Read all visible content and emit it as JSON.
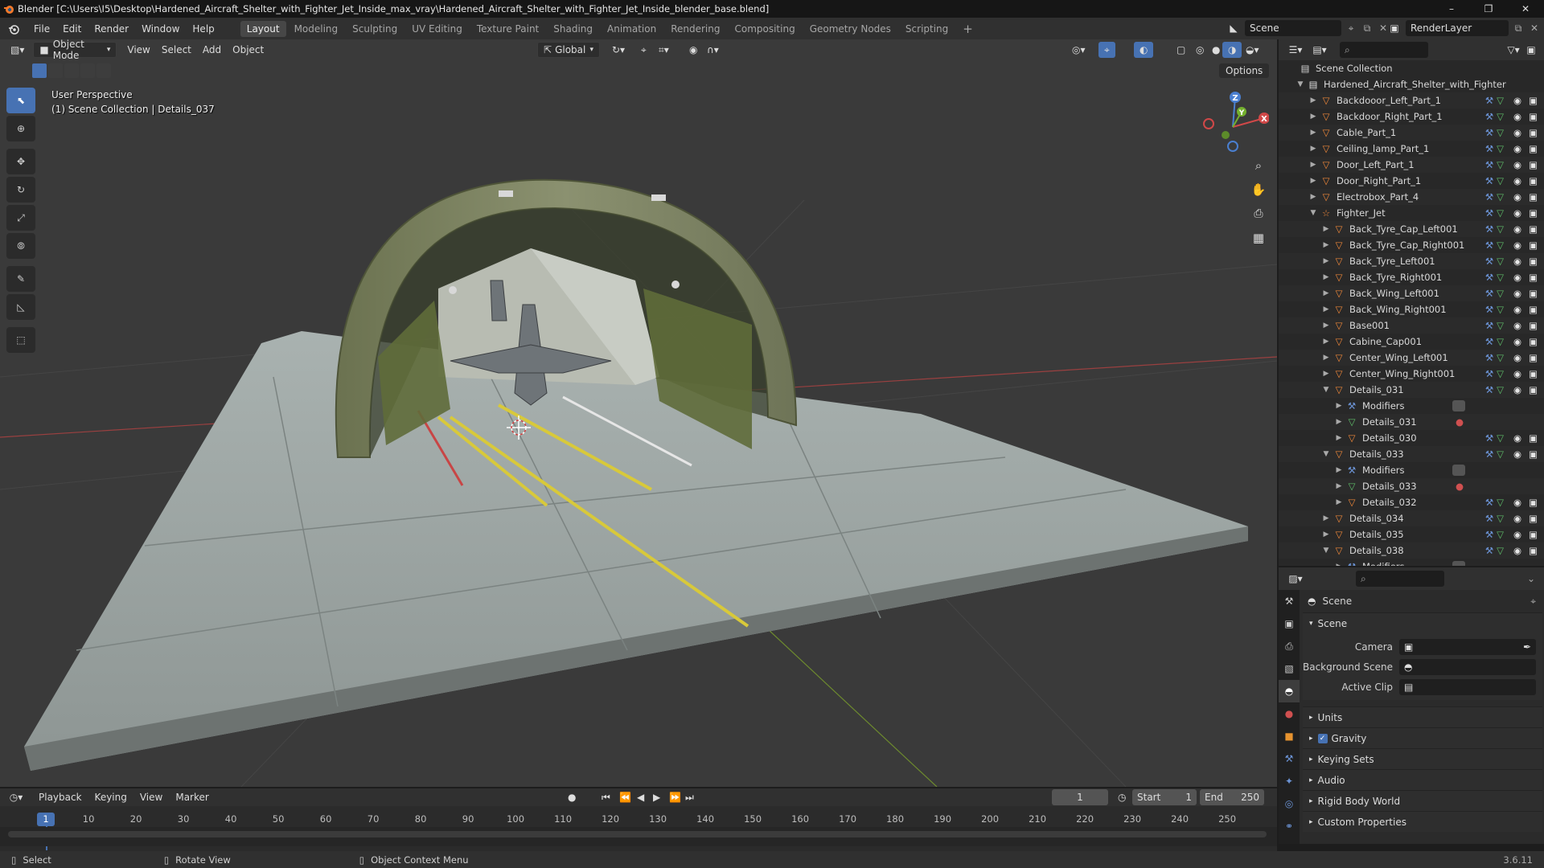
{
  "window": {
    "title": "Blender [C:\\Users\\I5\\Desktop\\Hardened_Aircraft_Shelter_with_Fighter_Jet_Inside_max_vray\\Hardened_Aircraft_Shelter_with_Fighter_Jet_Inside_blender_base.blend]"
  },
  "menu": [
    "File",
    "Edit",
    "Render",
    "Window",
    "Help"
  ],
  "workspaces": [
    "Layout",
    "Modeling",
    "Sculpting",
    "UV Editing",
    "Texture Paint",
    "Shading",
    "Animation",
    "Rendering",
    "Compositing",
    "Geometry Nodes",
    "Scripting"
  ],
  "active_workspace": "Layout",
  "add_workspace": "+",
  "scene_name": "Scene",
  "render_layer": "RenderLayer",
  "viewport": {
    "mode": "Object Mode",
    "menu": [
      "View",
      "Select",
      "Add",
      "Object"
    ],
    "orientation": "Global",
    "options": "Options",
    "perspective": "User Perspective",
    "collection_info": "(1) Scene Collection | Details_037",
    "gizmo_x": "X",
    "gizmo_y": "Y",
    "gizmo_z": "Z"
  },
  "outliner": {
    "root": "Scene Collection",
    "rows": [
      {
        "depth": 0,
        "label": "Hardened_Aircraft_Shelter_with_Fighter",
        "icon": "collection-icon",
        "expanded": true
      },
      {
        "depth": 1,
        "label": "Backdooor_Left_Part_1",
        "icon": "mesh-object-icon"
      },
      {
        "depth": 1,
        "label": "Backdoor_Right_Part_1",
        "icon": "mesh-object-icon"
      },
      {
        "depth": 1,
        "label": "Cable_Part_1",
        "icon": "mesh-object-icon"
      },
      {
        "depth": 1,
        "label": "Ceiling_lamp_Part_1",
        "icon": "mesh-object-icon"
      },
      {
        "depth": 1,
        "label": "Door_Left_Part_1",
        "icon": "mesh-object-icon"
      },
      {
        "depth": 1,
        "label": "Door_Right_Part_1",
        "icon": "mesh-object-icon"
      },
      {
        "depth": 1,
        "label": "Electrobox_Part_4",
        "icon": "mesh-object-icon"
      },
      {
        "depth": 1,
        "label": "Fighter_Jet",
        "icon": "empty-object-icon",
        "expanded": true
      },
      {
        "depth": 2,
        "label": "Back_Tyre_Cap_Left001",
        "icon": "mesh-object-icon"
      },
      {
        "depth": 2,
        "label": "Back_Tyre_Cap_Right001",
        "icon": "mesh-object-icon"
      },
      {
        "depth": 2,
        "label": "Back_Tyre_Left001",
        "icon": "mesh-object-icon"
      },
      {
        "depth": 2,
        "label": "Back_Tyre_Right001",
        "icon": "mesh-object-icon"
      },
      {
        "depth": 2,
        "label": "Back_Wing_Left001",
        "icon": "mesh-object-icon"
      },
      {
        "depth": 2,
        "label": "Back_Wing_Right001",
        "icon": "mesh-object-icon"
      },
      {
        "depth": 2,
        "label": "Base001",
        "icon": "mesh-object-icon"
      },
      {
        "depth": 2,
        "label": "Cabine_Cap001",
        "icon": "mesh-object-icon"
      },
      {
        "depth": 2,
        "label": "Center_Wing_Left001",
        "icon": "mesh-object-icon"
      },
      {
        "depth": 2,
        "label": "Center_Wing_Right001",
        "icon": "mesh-object-icon"
      },
      {
        "depth": 2,
        "label": "Details_031",
        "icon": "mesh-object-icon",
        "expanded": true
      },
      {
        "depth": 3,
        "label": "Modifiers",
        "icon": "modifier-icon"
      },
      {
        "depth": 3,
        "label": "Details_031",
        "icon": "mesh-data-icon"
      },
      {
        "depth": 3,
        "label": "Details_030",
        "icon": "mesh-object-icon"
      },
      {
        "depth": 2,
        "label": "Details_033",
        "icon": "mesh-object-icon",
        "expanded": true
      },
      {
        "depth": 3,
        "label": "Modifiers",
        "icon": "modifier-icon"
      },
      {
        "depth": 3,
        "label": "Details_033",
        "icon": "mesh-data-icon"
      },
      {
        "depth": 3,
        "label": "Details_032",
        "icon": "mesh-object-icon"
      },
      {
        "depth": 2,
        "label": "Details_034",
        "icon": "mesh-object-icon"
      },
      {
        "depth": 2,
        "label": "Details_035",
        "icon": "mesh-object-icon"
      },
      {
        "depth": 2,
        "label": "Details_038",
        "icon": "mesh-object-icon",
        "expanded": true
      },
      {
        "depth": 3,
        "label": "Modifiers",
        "icon": "modifier-icon"
      }
    ]
  },
  "properties": {
    "context": "Scene",
    "panel": "Scene",
    "fields": [
      {
        "label": "Camera",
        "value": ""
      },
      {
        "label": "Background Scene",
        "value": ""
      },
      {
        "label": "Active Clip",
        "value": ""
      }
    ],
    "subpanels": [
      "Units",
      "Gravity",
      "Keying Sets",
      "Audio",
      "Rigid Body World",
      "Custom Properties"
    ],
    "gravity_checked": true
  },
  "timeline": {
    "menu": [
      "Playback",
      "Keying",
      "View",
      "Marker"
    ],
    "current_frame": "1",
    "start_label": "Start",
    "start": "1",
    "end_label": "End",
    "end": "250",
    "ticks": [
      "1",
      "10",
      "20",
      "30",
      "40",
      "50",
      "60",
      "70",
      "80",
      "90",
      "100",
      "110",
      "120",
      "130",
      "140",
      "150",
      "160",
      "170",
      "180",
      "190",
      "200",
      "210",
      "220",
      "230",
      "240",
      "250"
    ]
  },
  "status": {
    "select": "Select",
    "rotate": "Rotate View",
    "context_menu": "Object Context Menu",
    "version": "3.6.11"
  }
}
